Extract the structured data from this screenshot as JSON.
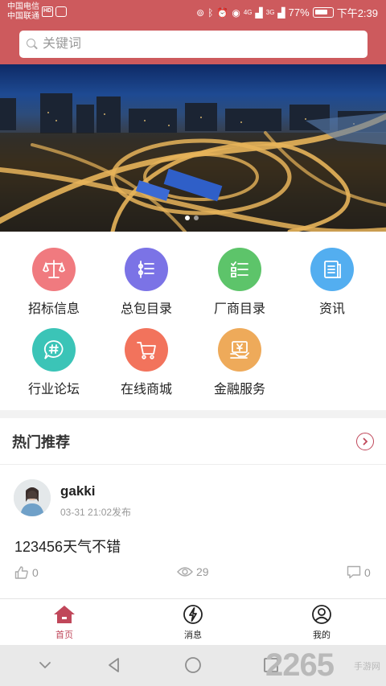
{
  "status_bar": {
    "carrier_1": "中国电信",
    "carrier_2": "中国联通",
    "sim_badge": "HD",
    "signal_1": "4G",
    "signal_2": "3G",
    "battery": "77%",
    "time": "下午2:39"
  },
  "search": {
    "placeholder": "关键词"
  },
  "banner": {
    "slide_count": 2,
    "active_slide": 1
  },
  "categories": [
    {
      "label": "招标信息",
      "color": "#f07a7f",
      "icon": "scale-icon"
    },
    {
      "label": "总包目录",
      "color": "#7b73e6",
      "icon": "list-icon"
    },
    {
      "label": "厂商目录",
      "color": "#5dc46a",
      "icon": "checklist-icon"
    },
    {
      "label": "资讯",
      "color": "#53aef0",
      "icon": "news-icon"
    },
    {
      "label": "行业论坛",
      "color": "#3bc4b7",
      "icon": "chat-hash-icon"
    },
    {
      "label": "在线商城",
      "color": "#f2735c",
      "icon": "cart-icon"
    },
    {
      "label": "金融服务",
      "color": "#eeaa5a",
      "icon": "finance-icon"
    }
  ],
  "hot": {
    "title": "热门推荐",
    "post": {
      "username": "gakki",
      "time": "03-31 21:02发布",
      "text": "123456天气不错",
      "likes": "0",
      "views": "29",
      "comments": "0"
    }
  },
  "bottom_nav": [
    {
      "label": "首页",
      "icon": "home-icon",
      "active": true
    },
    {
      "label": "消息",
      "icon": "lightning-icon",
      "active": false
    },
    {
      "label": "我的",
      "icon": "user-icon",
      "active": false
    }
  ],
  "watermark": {
    "text": "2265",
    "sub": "手游网"
  },
  "colors": {
    "accent": "#c0475a",
    "header": "#cd5a5d"
  }
}
